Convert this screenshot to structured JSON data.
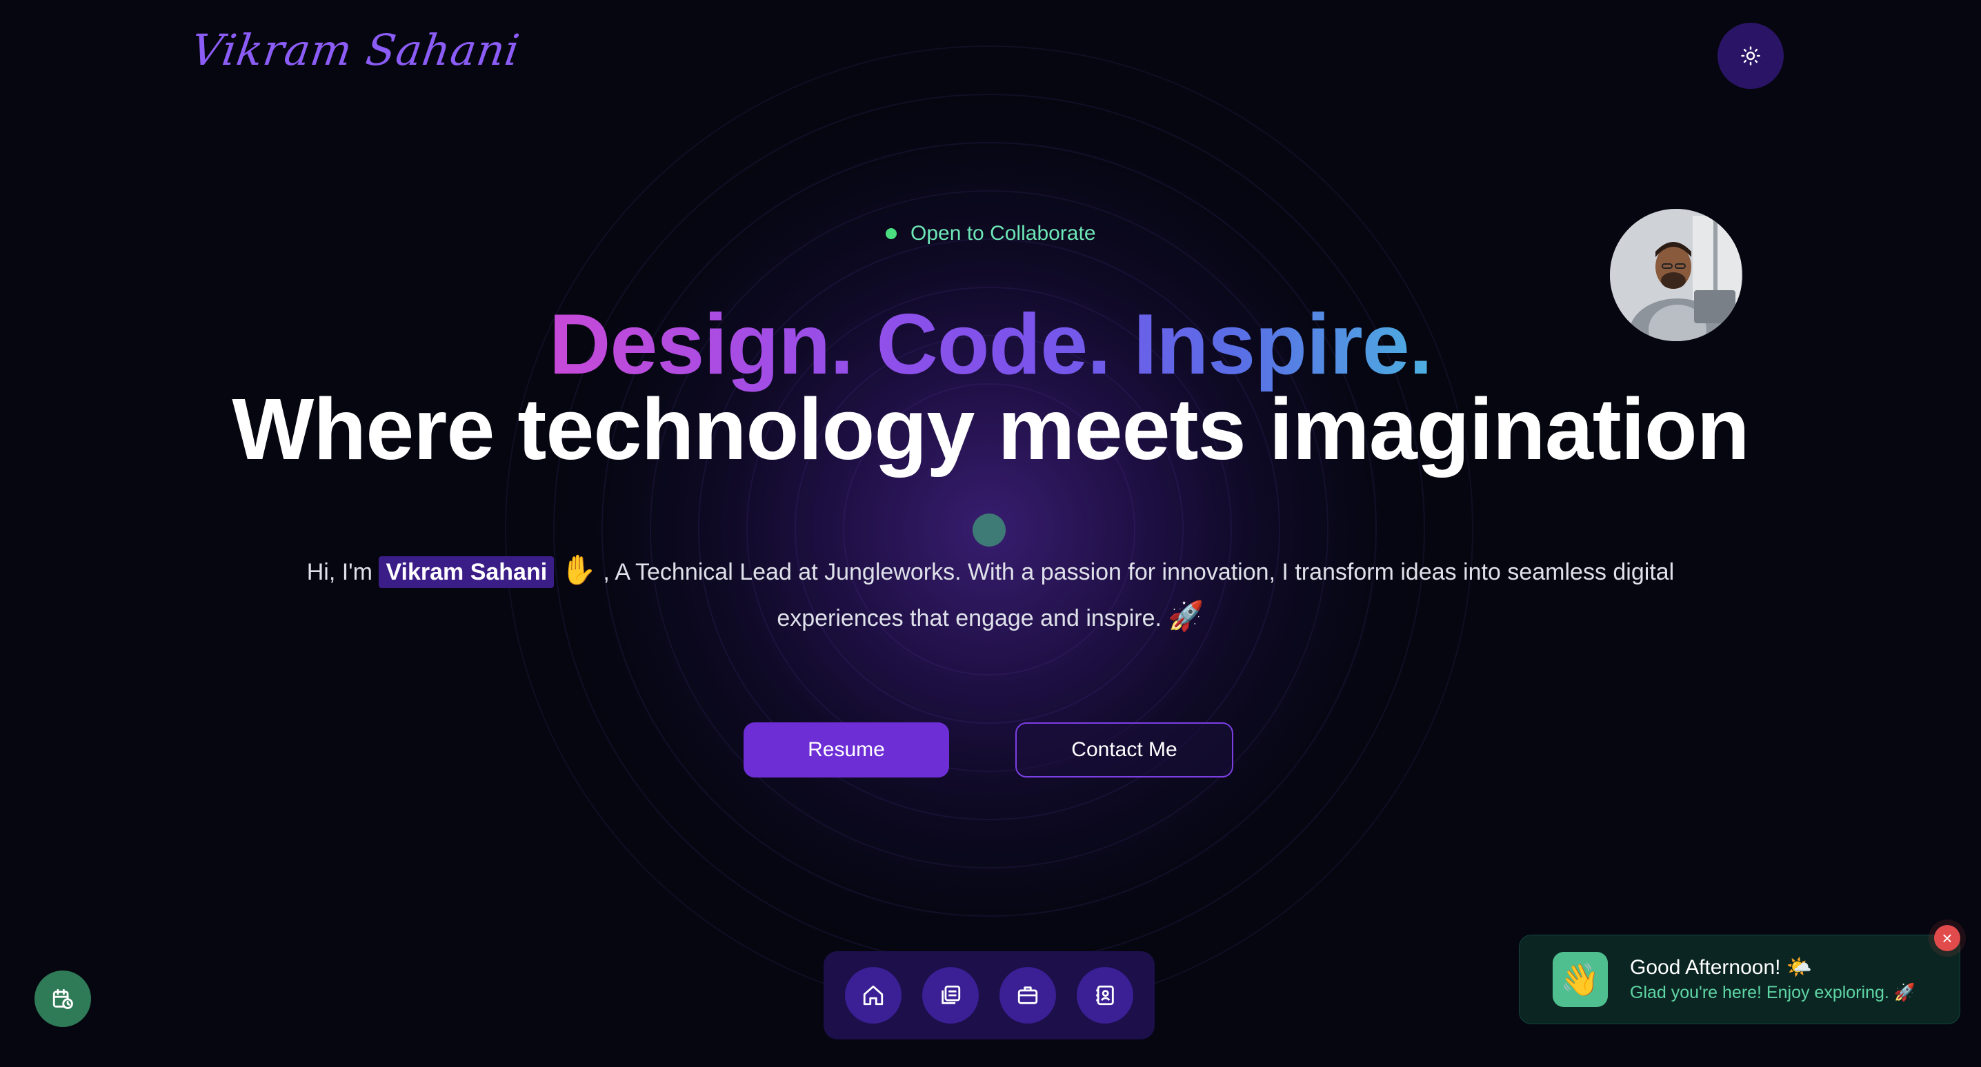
{
  "header": {
    "logo_text": "Vikram Sahani",
    "theme_toggle_icon": "sun-icon"
  },
  "hero": {
    "status_text": "Open to Collaborate",
    "headline_gradient": "Design. Code. Inspire.",
    "headline_main": "Where technology meets imagination",
    "intro_prefix": "Hi, I'm",
    "intro_name": "Vikram Sahani",
    "intro_wave_emoji": "✋",
    "intro_body": ", A Technical Lead at Jungleworks. With a passion for innovation, I transform ideas into seamless digital experiences that engage and inspire.",
    "intro_rocket_emoji": "🚀",
    "avatar_alt": "Vikram Sahani portrait"
  },
  "actions": {
    "resume_label": "Resume",
    "contact_label": "Contact Me"
  },
  "dock": {
    "items": [
      {
        "icon": "home-icon"
      },
      {
        "icon": "projects-icon"
      },
      {
        "icon": "briefcase-icon"
      },
      {
        "icon": "contact-card-icon"
      }
    ]
  },
  "schedule_button": {
    "icon": "calendar-clock-icon"
  },
  "toast": {
    "icon_emoji": "👋",
    "title": "Good Afternoon! 🌤️",
    "subtitle": "Glad you're here! Enjoy exploring. 🚀",
    "close_label": "×"
  },
  "colors": {
    "background": "#05060f",
    "accent": "#6d2ed6",
    "status_green": "#6ee7b7",
    "toast_bg": "#0b2622"
  }
}
